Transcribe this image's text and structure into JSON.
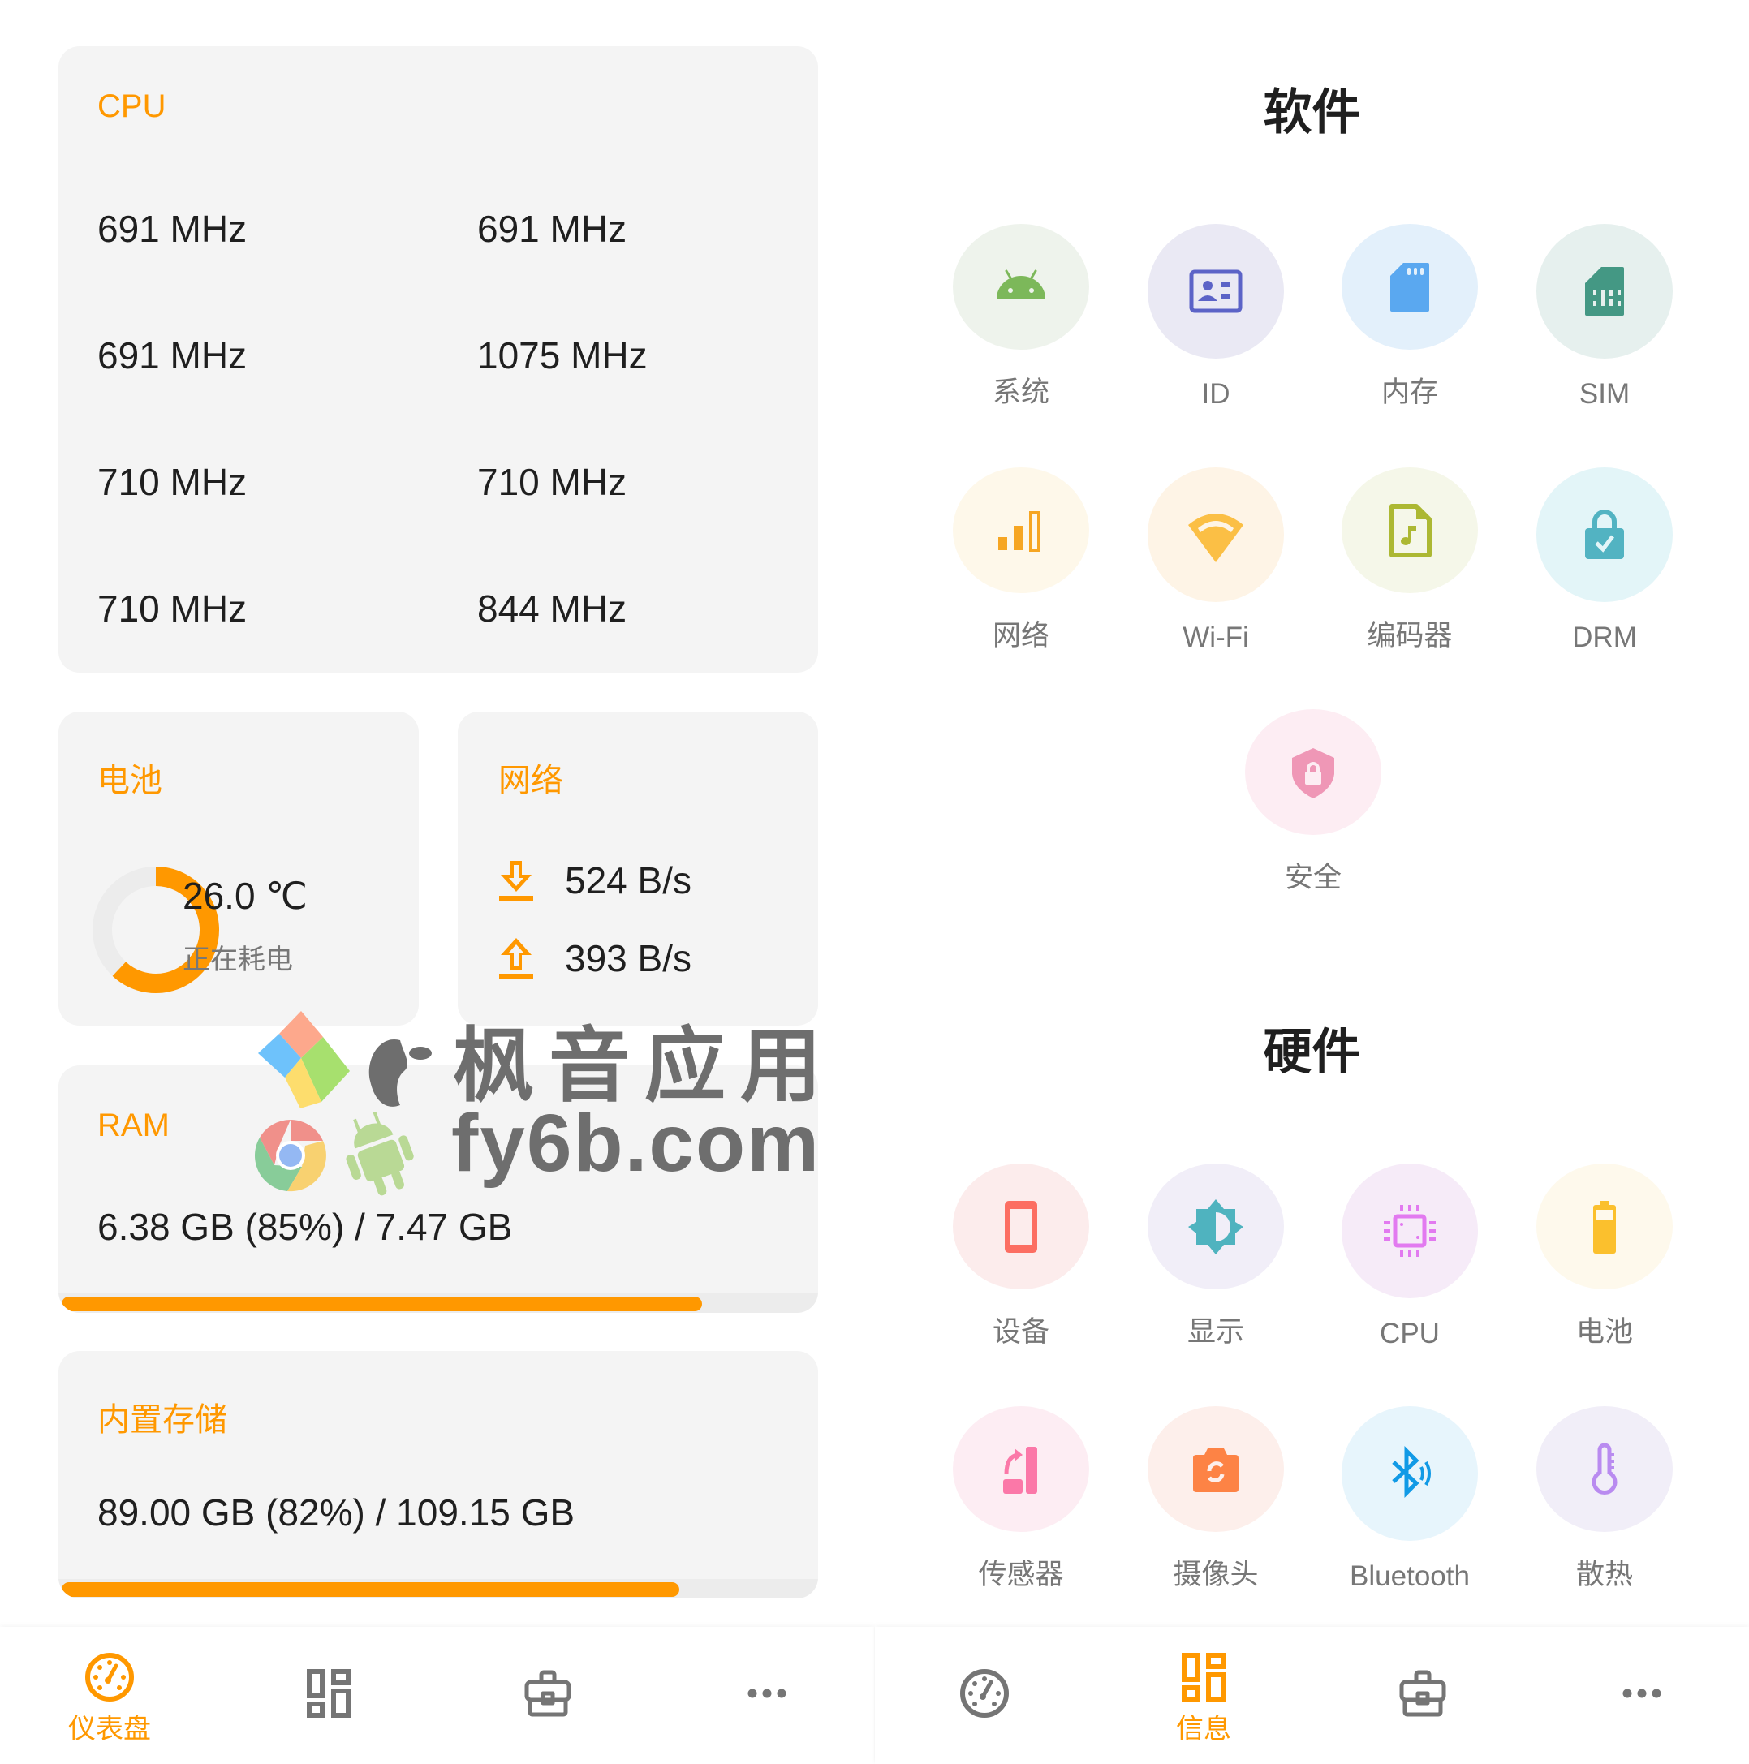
{
  "accent_color": "#ff9800",
  "left": {
    "cpu": {
      "title": "CPU",
      "frequencies": [
        "691 MHz",
        "691 MHz",
        "691 MHz",
        "1075 MHz",
        "710 MHz",
        "710 MHz",
        "710 MHz",
        "844 MHz"
      ]
    },
    "battery": {
      "title": "电池",
      "temperature": "26.0 ℃",
      "status": "正在耗电",
      "level_fraction": 0.62
    },
    "network": {
      "title": "网络",
      "download": "524 B/s",
      "upload": "393 B/s",
      "download_icon": "download-arrow-icon",
      "upload_icon": "upload-arrow-icon"
    },
    "ram": {
      "title": "RAM",
      "usage": "6.38 GB (85%) / 7.47 GB",
      "used_fraction": 0.85
    },
    "storage": {
      "title": "内置存储",
      "usage": "89.00 GB (82%) / 109.15 GB",
      "used_fraction": 0.82
    },
    "watermark": {
      "line1": "枫音应用",
      "line2": "fy6b.com"
    },
    "nav": [
      {
        "label": "仪表盘",
        "icon": "dashboard-gauge-icon",
        "active": true
      },
      {
        "label": "",
        "icon": "info-grid-icon",
        "active": false
      },
      {
        "label": "",
        "icon": "toolbox-icon",
        "active": false
      },
      {
        "label": "",
        "icon": "more-dots-icon",
        "active": false
      }
    ]
  },
  "right": {
    "software": {
      "title": "软件",
      "items": [
        {
          "label": "系统",
          "icon": "android-icon",
          "color": "#7cb85a",
          "bg": "#eef3ec"
        },
        {
          "label": "ID",
          "icon": "id-card-icon",
          "color": "#5c63c7",
          "bg": "#eae9f4"
        },
        {
          "label": "内存",
          "icon": "sd-card-icon",
          "color": "#5aa8f0",
          "bg": "#e3f0fb"
        },
        {
          "label": "SIM",
          "icon": "sim-card-icon",
          "color": "#449884",
          "bg": "#e6f0ee"
        },
        {
          "label": "网络",
          "icon": "signal-bars-icon",
          "color": "#f6a623",
          "bg": "#fef8ea"
        },
        {
          "label": "Wi-Fi",
          "icon": "wifi-icon",
          "color": "#fbbf45",
          "bg": "#fef4e6"
        },
        {
          "label": "编码器",
          "icon": "audio-file-icon",
          "color": "#acb833",
          "bg": "#f5f7e9"
        },
        {
          "label": "DRM",
          "icon": "lock-check-icon",
          "color": "#52b3c2",
          "bg": "#e3f5f8"
        },
        {
          "label": "安全",
          "icon": "shield-lock-icon",
          "color": "#ef97b6",
          "bg": "#fdedf3"
        }
      ]
    },
    "hardware": {
      "title": "硬件",
      "items": [
        {
          "label": "设备",
          "icon": "phone-icon",
          "color": "#fc6e62",
          "bg": "#fcecec"
        },
        {
          "label": "显示",
          "icon": "brightness-icon",
          "color": "#4fb3bf",
          "bg": "#f1eef8"
        },
        {
          "label": "CPU",
          "icon": "cpu-chip-icon",
          "color": "#e27af0",
          "bg": "#f6ebf8"
        },
        {
          "label": "电池",
          "icon": "battery-icon",
          "color": "#fbc02d",
          "bg": "#fef9ec"
        },
        {
          "label": "传感器",
          "icon": "screen-rotation-icon",
          "color": "#fb78a8",
          "bg": "#fdedf3"
        },
        {
          "label": "摄像头",
          "icon": "camera-switch-icon",
          "color": "#fd8345",
          "bg": "#fdefeb"
        },
        {
          "label": "Bluetooth",
          "icon": "bluetooth-icon",
          "color": "#119ae6",
          "bg": "#e7f5fc"
        },
        {
          "label": "散热",
          "icon": "thermometer-icon",
          "color": "#b98bf0",
          "bg": "#f1eef8"
        }
      ]
    },
    "nav": [
      {
        "label": "",
        "icon": "dashboard-gauge-icon",
        "active": false
      },
      {
        "label": "信息",
        "icon": "info-grid-icon",
        "active": true
      },
      {
        "label": "",
        "icon": "toolbox-icon",
        "active": false
      },
      {
        "label": "",
        "icon": "more-dots-icon",
        "active": false
      }
    ]
  }
}
